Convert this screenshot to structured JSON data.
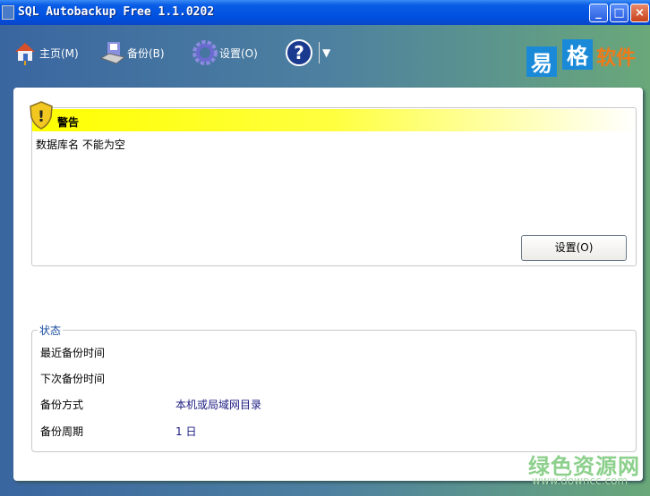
{
  "window": {
    "title": "SQL Autobackup Free 1.1.0202"
  },
  "toolbar": {
    "home": "主页(M)",
    "backup": "备份(B)",
    "settings": "设置(O)",
    "help_dropdown": "▼"
  },
  "logo": {
    "text_a": "易",
    "text_b": "格",
    "text_c": "软件"
  },
  "warning": {
    "title": "警告",
    "message": "数据库名 不能为空",
    "button": "设置(O)"
  },
  "status": {
    "legend": "状态",
    "rows": [
      {
        "label": "最近备份时间",
        "value": ""
      },
      {
        "label": "下次备份时间",
        "value": ""
      },
      {
        "label": "备份方式",
        "value": "本机或局域网目录"
      },
      {
        "label": "备份周期",
        "value": "1 日"
      }
    ]
  },
  "watermark": {
    "name": "绿色资源网",
    "url": "www.downcc.com"
  }
}
